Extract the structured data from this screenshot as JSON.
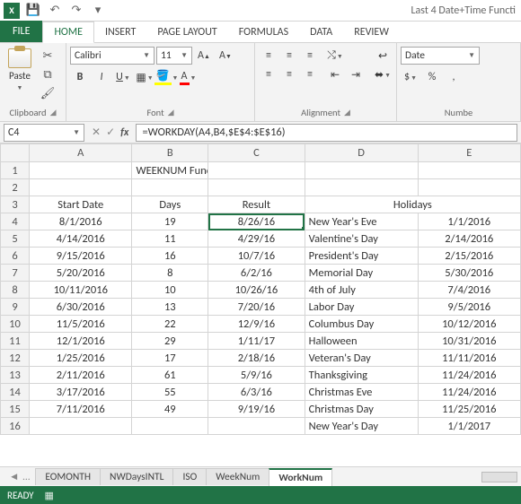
{
  "titlebar": {
    "app_icon": "X",
    "title": "Last 4 Date+Time Functi"
  },
  "qat": {
    "save": "💾",
    "undo": "↶",
    "redo": "↷",
    "more": "▾"
  },
  "tabs": {
    "file": "FILE",
    "home": "HOME",
    "insert": "INSERT",
    "pagelayout": "PAGE LAYOUT",
    "formulas": "FORMULAS",
    "data": "DATA",
    "review": "REVIEW"
  },
  "ribbon": {
    "clipboard": {
      "paste": "Paste",
      "label": "Clipboard"
    },
    "font": {
      "name": "Calibri",
      "size": "11",
      "label": "Font"
    },
    "alignment": {
      "label": "Alignment"
    },
    "number": {
      "format": "Date",
      "label": "Numbe"
    }
  },
  "formula_bar": {
    "cell_ref": "C4",
    "formula": "=WORKDAY(A4,B4,$E$4:$E$16)"
  },
  "grid": {
    "columns": [
      "A",
      "B",
      "C",
      "D",
      "E"
    ],
    "title": "WEEKNUM Function",
    "headers": {
      "start_date": "Start Date",
      "days": "Days",
      "result": "Result",
      "holidays": "Holidays"
    },
    "rows": [
      {
        "n": 4,
        "a": "8/1/2016",
        "b": "19",
        "c": "8/26/16",
        "d": "New Year's Eve",
        "e": "1/1/2016"
      },
      {
        "n": 5,
        "a": "4/14/2016",
        "b": "11",
        "c": "4/29/16",
        "d": "Valentine's Day",
        "e": "2/14/2016"
      },
      {
        "n": 6,
        "a": "9/15/2016",
        "b": "16",
        "c": "10/7/16",
        "d": "President's Day",
        "e": "2/15/2016"
      },
      {
        "n": 7,
        "a": "5/20/2016",
        "b": "8",
        "c": "6/2/16",
        "d": "Memorial Day",
        "e": "5/30/2016"
      },
      {
        "n": 8,
        "a": "10/11/2016",
        "b": "10",
        "c": "10/26/16",
        "d": "4th of July",
        "e": "7/4/2016"
      },
      {
        "n": 9,
        "a": "6/30/2016",
        "b": "13",
        "c": "7/20/16",
        "d": "Labor Day",
        "e": "9/5/2016"
      },
      {
        "n": 10,
        "a": "11/5/2016",
        "b": "22",
        "c": "12/9/16",
        "d": "Columbus Day",
        "e": "10/12/2016"
      },
      {
        "n": 11,
        "a": "12/1/2016",
        "b": "29",
        "c": "1/11/17",
        "d": "Halloween",
        "e": "10/31/2016"
      },
      {
        "n": 12,
        "a": "1/25/2016",
        "b": "17",
        "c": "2/18/16",
        "d": "Veteran's Day",
        "e": "11/11/2016"
      },
      {
        "n": 13,
        "a": "2/11/2016",
        "b": "61",
        "c": "5/9/16",
        "d": "Thanksgiving",
        "e": "11/24/2016"
      },
      {
        "n": 14,
        "a": "3/17/2016",
        "b": "55",
        "c": "6/3/16",
        "d": "Christmas Eve",
        "e": "11/24/2016"
      },
      {
        "n": 15,
        "a": "7/11/2016",
        "b": "49",
        "c": "9/19/16",
        "d": "Christmas Day",
        "e": "11/25/2016"
      },
      {
        "n": 16,
        "a": "",
        "b": "",
        "c": "",
        "d": "New Year's Day",
        "e": "1/1/2017"
      }
    ]
  },
  "sheets": {
    "dots": "…",
    "s1": "EOMONTH",
    "s2": "NWDaysINTL",
    "s3": "ISO",
    "s4": "WeekNum",
    "s5": "WorkNum"
  },
  "status": {
    "ready": "READY"
  }
}
